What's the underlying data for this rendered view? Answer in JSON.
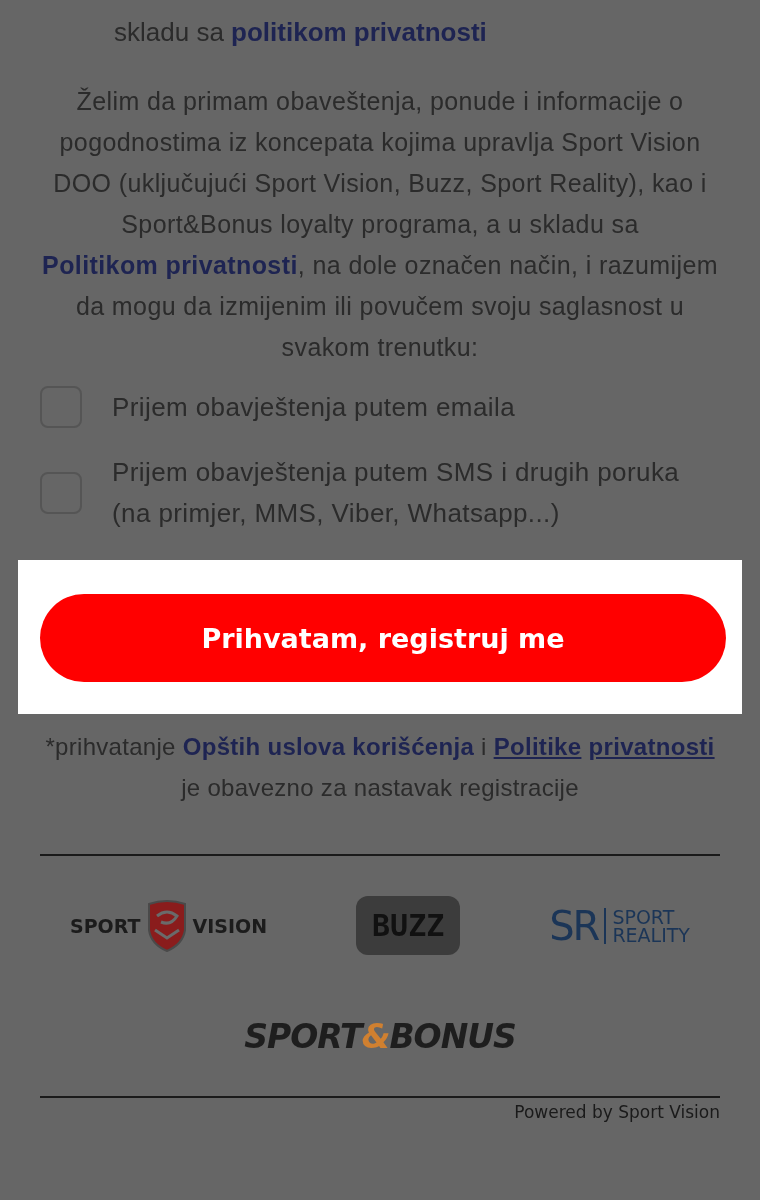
{
  "intro": [
    {
      "kind": "text",
      "text": "skladu sa "
    },
    {
      "kind": "link",
      "text": "politikom privatnosti",
      "underlined": false
    }
  ],
  "consent": [
    {
      "kind": "text",
      "text": "Želim da primam obaveštenja, ponude i informacije o pogodnostima iz koncepata kojima upravlja Sport Vision DOO (uključujući Sport Vision, Buzz, Sport Reality), kao i Sport&Bonus loyalty programa, a u skladu sa "
    },
    {
      "kind": "link",
      "text": "Politikom privatnosti",
      "underlined": false
    },
    {
      "kind": "text",
      "text": ", na dole označen način, i razumijem da mogu da izmijenim ili povučem svoju saglasnost u svakom trenutku:"
    }
  ],
  "options": [
    {
      "kind": "checkbox",
      "label": "Prijem obavještenja putem emaila",
      "checked": false
    },
    {
      "kind": "checkbox",
      "label": "Prijem obavještenja putem SMS i drugih poruka (na primjer, MMS, Viber, Whatsapp...)",
      "checked": false
    }
  ],
  "submit_button": {
    "label": "Prihvatam, registruj me",
    "highlighted": true
  },
  "note": [
    {
      "kind": "text",
      "text": "*prihvatanje "
    },
    {
      "kind": "link",
      "text": "Opštih uslova korišćenja",
      "underlined": false
    },
    {
      "kind": "text",
      "text": " i "
    },
    {
      "kind": "link",
      "text": "Politike",
      "underlined": true
    },
    {
      "kind": "link",
      "text": "privatnosti",
      "underlined": true
    },
    {
      "kind": "text",
      "text": " je obavezno za nastavak registracije"
    }
  ],
  "logos": {
    "sport_vision": [
      "SPORT",
      "VISION"
    ],
    "buzz": "BUZZ",
    "sport_reality": {
      "mark": "SR",
      "name": [
        "SPORT",
        "REALITY"
      ]
    },
    "sport_bonus": [
      "SPORT",
      "&",
      "BONUS"
    ]
  },
  "footer": "Powered by Sport Vision"
}
